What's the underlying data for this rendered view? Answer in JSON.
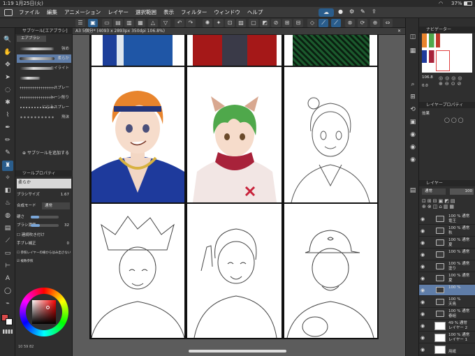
{
  "status": {
    "time": "1:19",
    "date": "1月25日(火)",
    "battery": "37%"
  },
  "menu": [
    "ファイル",
    "編集",
    "アニメーション",
    "レイヤー",
    "選択範囲",
    "表示",
    "フィルター",
    "ウィンドウ",
    "ヘルプ"
  ],
  "doc_tab": "A3 5個分* (4093 x 2893px 350dpi 106.8%)",
  "subtool": {
    "header": "サブツール[エアブラシ]",
    "tabs": [
      "エアブラシ"
    ],
    "brushes": [
      "強め",
      "柔らか",
      "ハイライト",
      "スプレー",
      "トーン削り",
      "にじみスプレー",
      "飛沫"
    ],
    "add_label": "サブツールを追加する"
  },
  "toolprop": {
    "header": "ツールプロパティ",
    "name": "柔らか",
    "brush_size_label": "ブラシサイズ",
    "brush_size": "1.67",
    "blend_label": "合成モード",
    "blend": "通常",
    "hardness_label": "硬さ",
    "density_label": "ブラシ濃度",
    "density": "32",
    "continuous_label": "連続吹き付け",
    "stabilize_label": "手ブレ補正",
    "stabilize": "0",
    "ref_label": "参照レイヤーの線からはみ出さない",
    "multi_label": "複数参照"
  },
  "color": {
    "main": "#d94a4a",
    "sub": "#ffffff",
    "values": [
      "10",
      "59",
      "82"
    ]
  },
  "navigator": {
    "header": "ナビゲーター",
    "zoom": "106.8",
    "angle": "0.0"
  },
  "layerprop": {
    "header": "レイヤープロパティ",
    "effect_label": "効果"
  },
  "layers_panel": {
    "header": "レイヤー",
    "blend": "通常",
    "opacity": "100"
  },
  "layers": [
    {
      "pct": "100 %",
      "mode": "通常",
      "name": "竜王",
      "type": "folder"
    },
    {
      "pct": "100 %",
      "mode": "通常",
      "name": "秋",
      "type": "folder"
    },
    {
      "pct": "100 %",
      "mode": "通常",
      "name": "夏",
      "type": "folder"
    },
    {
      "pct": "100 %",
      "mode": "通常",
      "name": "",
      "type": "folder"
    },
    {
      "pct": "100 %",
      "mode": "通常",
      "name": "塗り",
      "type": "folder"
    },
    {
      "pct": "100 %",
      "mode": "通常",
      "name": "夏",
      "type": "folder"
    },
    {
      "pct": "100 %",
      "mode": "",
      "name": "",
      "type": "folder",
      "selected": true
    },
    {
      "pct": "100 %",
      "mode": "",
      "name": "天鳥",
      "type": "folder"
    },
    {
      "pct": "100 %",
      "mode": "通常",
      "name": "春組",
      "type": "folder"
    },
    {
      "pct": "49 %",
      "mode": "通常",
      "name": "レイヤー 2",
      "type": "layer"
    },
    {
      "pct": "100 %",
      "mode": "通常",
      "name": "レイヤー 1",
      "type": "layer"
    },
    {
      "pct": "",
      "mode": "",
      "name": "用紙",
      "type": "paper"
    }
  ]
}
